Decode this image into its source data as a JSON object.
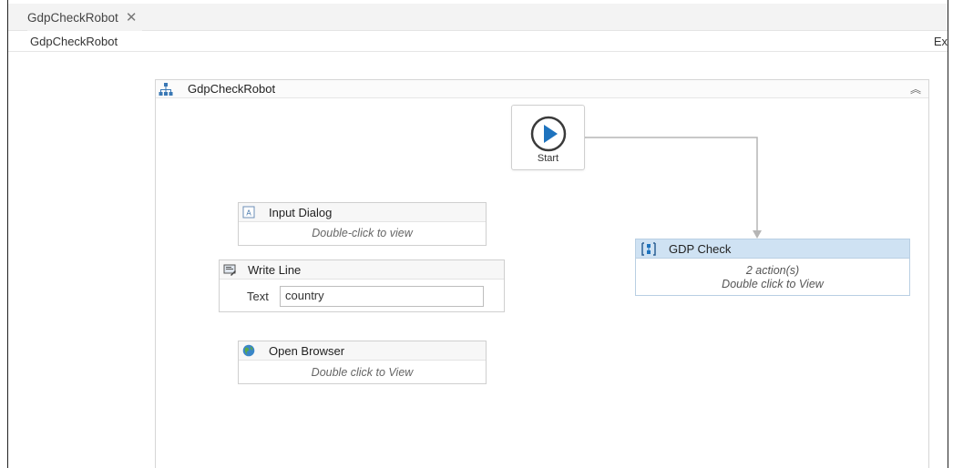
{
  "tabs": [
    {
      "label": "GdpCheckRobot",
      "close_icon": "close-icon"
    }
  ],
  "breadcrumb": "GdpCheckRobot",
  "expand_label": "Ex",
  "designer": {
    "title": "GdpCheckRobot",
    "icon": "sequence-icon",
    "collapse_glyph": "︽"
  },
  "start_node": {
    "label": "Start",
    "icon": "play-icon",
    "accent": "#1e73be"
  },
  "activities": {
    "input_dialog": {
      "name": "Input Dialog",
      "hint": "Double-click to view",
      "icon": "input-dialog-icon"
    },
    "write_line": {
      "name": "Write Line",
      "field_label": "Text",
      "field_value": "country",
      "icon": "write-line-icon"
    },
    "open_browser": {
      "name": "Open Browser",
      "hint": "Double click to View",
      "icon": "globe-icon"
    }
  },
  "gdp_check": {
    "name": "GDP Check",
    "actions": "2 action(s)",
    "hint": "Double click to View",
    "icon": "flow-decision-icon",
    "header_color": "#cfe2f3"
  }
}
